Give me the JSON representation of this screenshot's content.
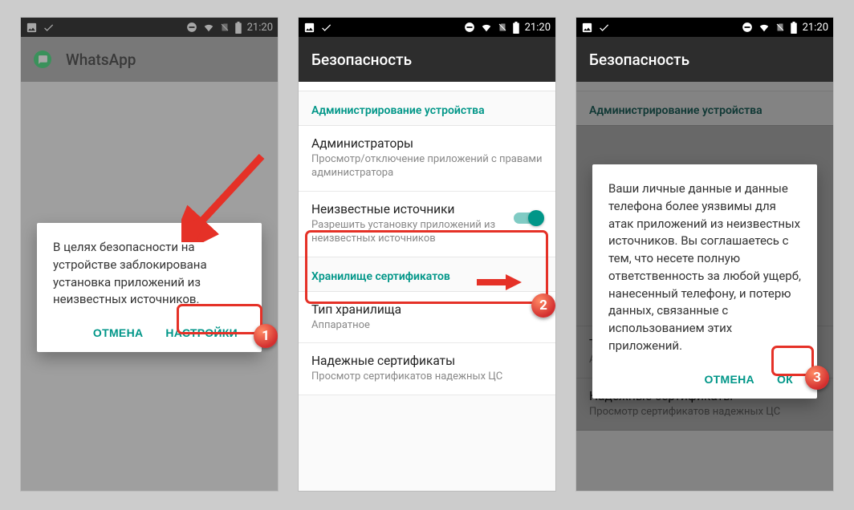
{
  "status": {
    "time": "21:20"
  },
  "screen1": {
    "app_name": "WhatsApp",
    "dialog_text": "В целях безопасности на устройстве заблокирована установка приложений из неизвестных источников.",
    "cancel": "ОТМЕНА",
    "settings": "НАСТРОЙКИ",
    "badge": "1"
  },
  "screen2": {
    "title": "Безопасность",
    "section_admin": "Администрирование устройства",
    "admins_title": "Администраторы",
    "admins_sub": "Просмотр/отключение приложений с правами администратора",
    "unknown_title": "Неизвестные источники",
    "unknown_sub": "Разрешить установку приложений из неизвестных источников",
    "section_storage": "Хранилище сертификатов",
    "storage_type_title": "Тип хранилища",
    "storage_type_sub": "Аппаратное",
    "certs_title": "Надежные сертификаты",
    "certs_sub": "Просмотр сертификатов надежных ЦС",
    "badge": "2"
  },
  "screen3": {
    "title": "Безопасность",
    "dialog_text": "Ваши личные данные и данные телефона более уязвимы для атак приложений из неизвестных источников. Вы соглашаетесь с тем, что несете полную ответственность за любой ущерб, нанесенный телефону, и потерю данных, связанные с использованием этих приложений.",
    "cancel": "ОТМЕНА",
    "ok": "ОК",
    "badge": "3"
  }
}
